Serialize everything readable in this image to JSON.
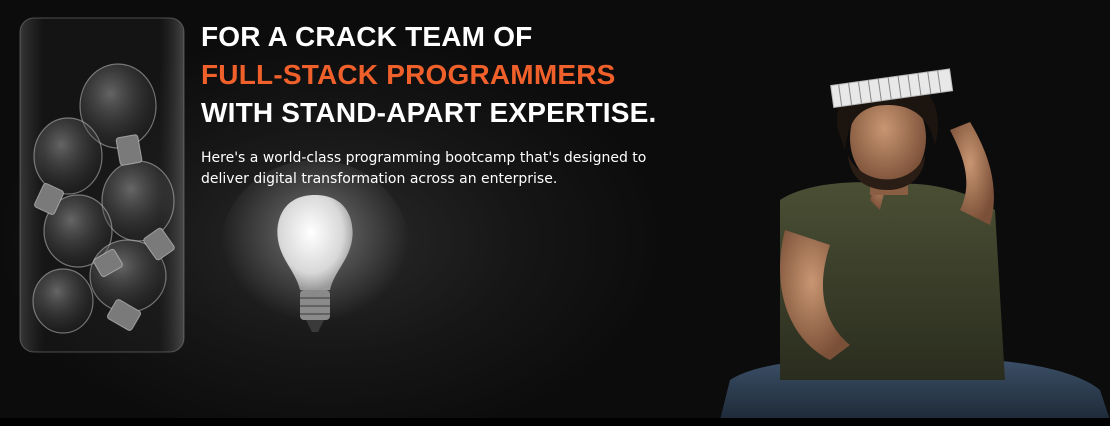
{
  "hero": {
    "headline_line1": "FOR A CRACK TEAM OF",
    "headline_line2": "FULL-STACK PROGRAMMERS",
    "headline_line3": "WITH STAND-APART EXPERTISE.",
    "description": "Here's a world-class programming bootcamp that's designed to deliver digital transformation across an enterprise."
  },
  "colors": {
    "accent": "#f0602a",
    "text": "#ffffff",
    "background": "#0c0c0c"
  },
  "images": {
    "jar": "glass-jar-of-lightbulbs-image",
    "bulb": "glowing-lightbulb-image",
    "person": "programmer-with-notebook-image"
  }
}
